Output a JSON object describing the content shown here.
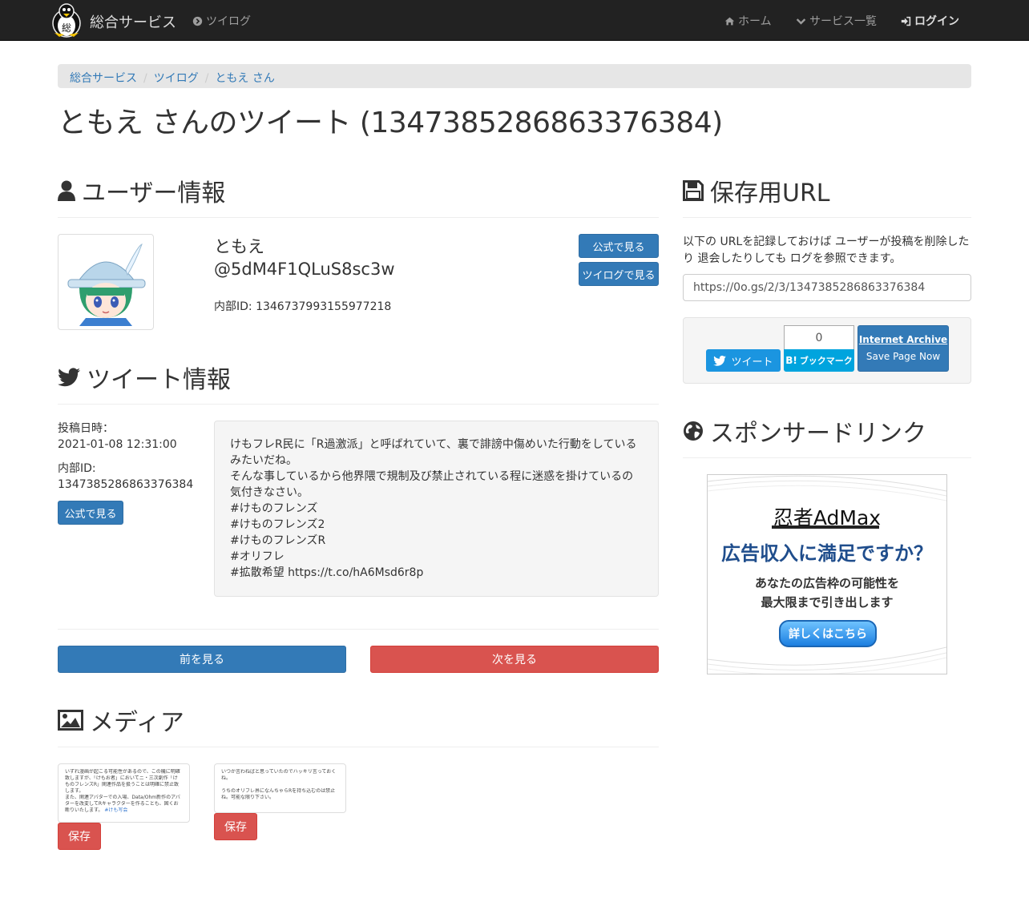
{
  "nav": {
    "brand": "総合サービス",
    "tsuilog": "ツイログ",
    "home": "ホーム",
    "services": "サービス一覧",
    "login": "ログイン"
  },
  "breadcrumb": [
    "総合サービス",
    "ツイログ",
    "ともえ さん"
  ],
  "page_title": "ともえ さんのツイート (1347385286863376384)",
  "user_section": {
    "title": "ユーザー情報",
    "name": "ともえ",
    "screen_name": "@5dM4F1QLuS8sc3w",
    "internal_id": "内部ID: 1346737993155977218",
    "btn_official": "公式で見る",
    "btn_tsuilog": "ツイログで見る"
  },
  "tweet_section": {
    "title": "ツイート情報",
    "posted_label": "投稿日時：",
    "posted_value": "2021-01-08 12:31:00",
    "internal_label": "内部ID:",
    "internal_value": "1347385286863376384",
    "btn_official": "公式で見る",
    "lines": [
      "けもフレR民に「R過激派」と呼ばれていて、裏で誹謗中傷めいた行動をしている",
      "みたいだね。",
      "そんな事しているから他界隈で規制及び禁止されている程に迷惑を掛けているの",
      "気付きなさい。",
      "#けものフレンズ",
      "#けものフレンズ2",
      "#けものフレンズR",
      "#オリフレ",
      "#拡散希望 https://t.co/hA6Msd6r8p"
    ]
  },
  "pager": {
    "prev": "前を見る",
    "next": "次を見る"
  },
  "media_section": {
    "title": "メディア",
    "save": "保存",
    "thumb1_lines": [
      "いずれ漫画が起こる可能性があるので、この機に明確",
      "致しますが、「けもお者」においてニ・三次創作「け",
      "ものフレンズR」関連作品を扱うことは明確に禁止致",
      "します。",
      "また、関連アバターでの入場、Data/Ohm新作のアバ",
      "ターを改変してRキャラクターを作ることも、固くお",
      "断りいたします。",
      "#けも写会"
    ],
    "thumb2_lines": [
      "いつか言わねばと思っていたのでハッキリ言っておく",
      "ね。",
      "",
      "うちのオリフレ界になんちゃらRを持ち込むのは禁止",
      "ね。可能な限り下さい。"
    ]
  },
  "save_section": {
    "title": "保存用URL",
    "description": "以下の URLを記録しておけば ユーザーが投稿を削除したり 退会したりしても ログを参照できます。",
    "url": "https://0o.gs/2/3/1347385286863376384",
    "tweet_btn": "ツイート",
    "hatena_count": "0",
    "hatena_btn": "ブックマーク",
    "ia_title": "Internet Archive",
    "ia_sub": "Save Page Now"
  },
  "sponsor_section": {
    "title": "スポンサードリンク",
    "ad_brand": "忍者AdMax",
    "ad_headline": "広告収入に満足ですか？",
    "ad_line1": "あなたの広告枠の可能性を",
    "ad_line2": "最大限まで引き出します",
    "ad_cta": "詳しくはこちら"
  }
}
